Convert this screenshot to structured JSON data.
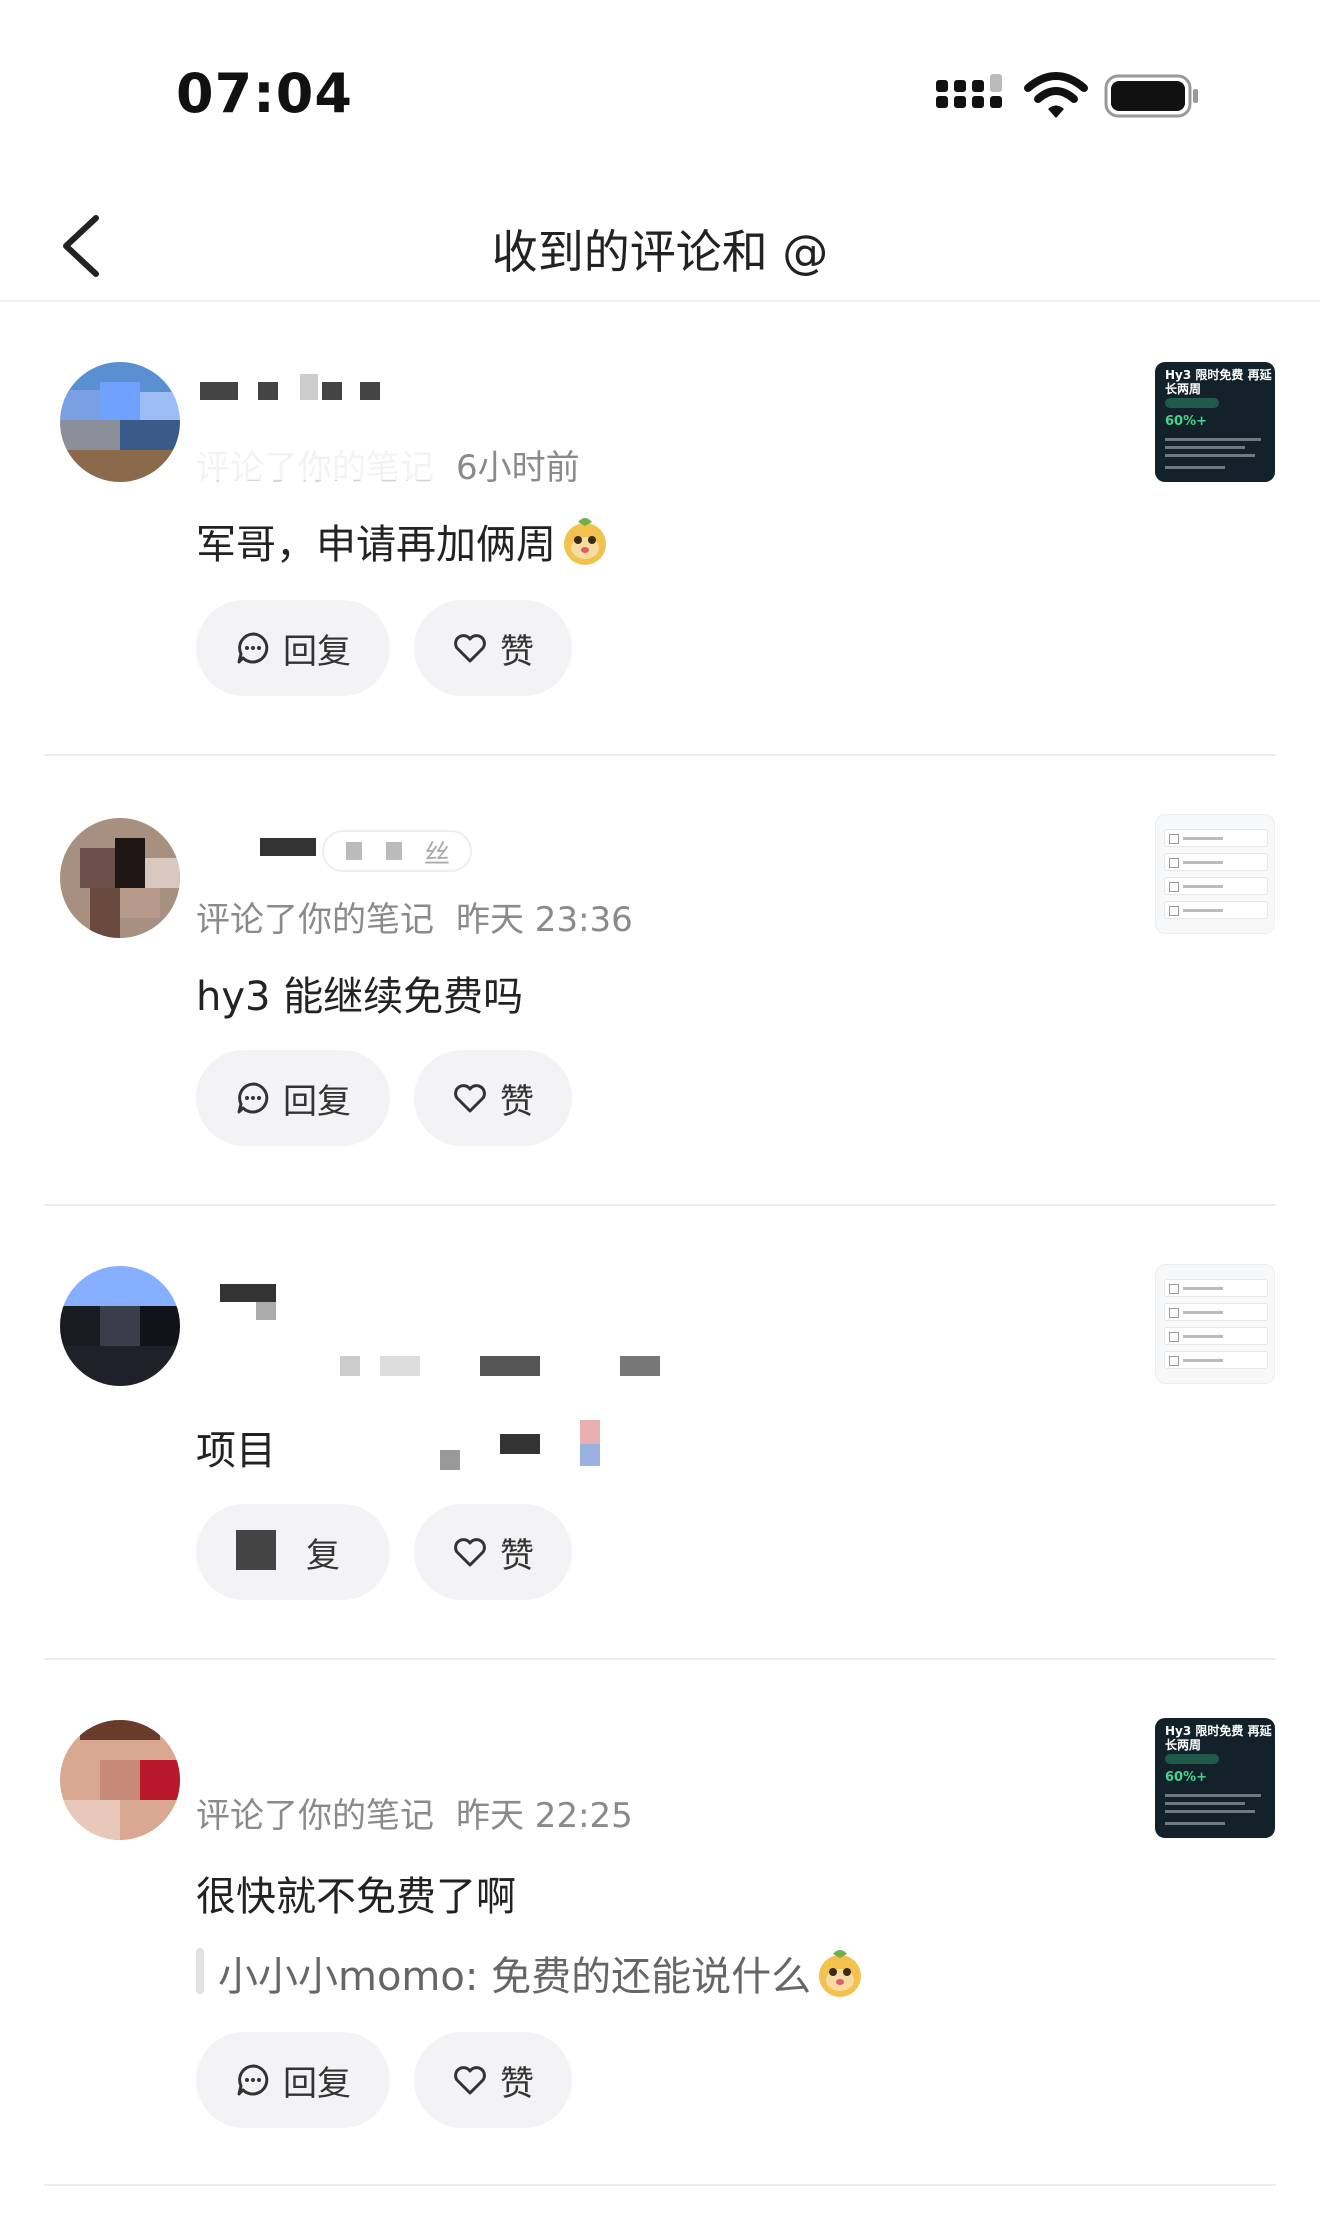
{
  "status_bar": {
    "time": "07:04"
  },
  "nav": {
    "title": "收到的评论和 @"
  },
  "buttons": {
    "reply": "回复",
    "like": "赞"
  },
  "comments": [
    {
      "meta_action": "评论了你的笔记",
      "time_ago": "6小时前",
      "text": "军哥，申请再加俩周",
      "thumbnail": {
        "type": "dark",
        "title": "Hy3 限时免费 再延长两周",
        "percent": "60%+"
      }
    },
    {
      "badge_fragment": "丝",
      "meta_action": "评论了你的笔记",
      "time_ago": "昨天 23:36",
      "text": "hy3 能继续免费吗",
      "thumbnail": {
        "type": "light"
      }
    },
    {
      "text_fragment": "项目",
      "reply_fragment": "复",
      "thumbnail": {
        "type": "light"
      }
    },
    {
      "meta_action": "评论了你的笔记",
      "time_ago": "昨天 22:25",
      "text": "很快就不免费了啊",
      "quote": "小小小momo: 免费的还能说什么",
      "thumbnail": {
        "type": "dark",
        "title": "Hy3 限时免费 再延长两周",
        "percent": "60%+"
      }
    }
  ],
  "icons": [
    "cellular-signal-icon",
    "wifi-icon",
    "battery-icon",
    "back-chevron-icon",
    "comment-bubble-icon",
    "heart-icon",
    "mascot-emoji-icon"
  ],
  "colors": {
    "background": "#ffffff",
    "button_bg": "#f3f3f5",
    "meta_text": "#8a8a8a",
    "divider": "#ececec"
  }
}
